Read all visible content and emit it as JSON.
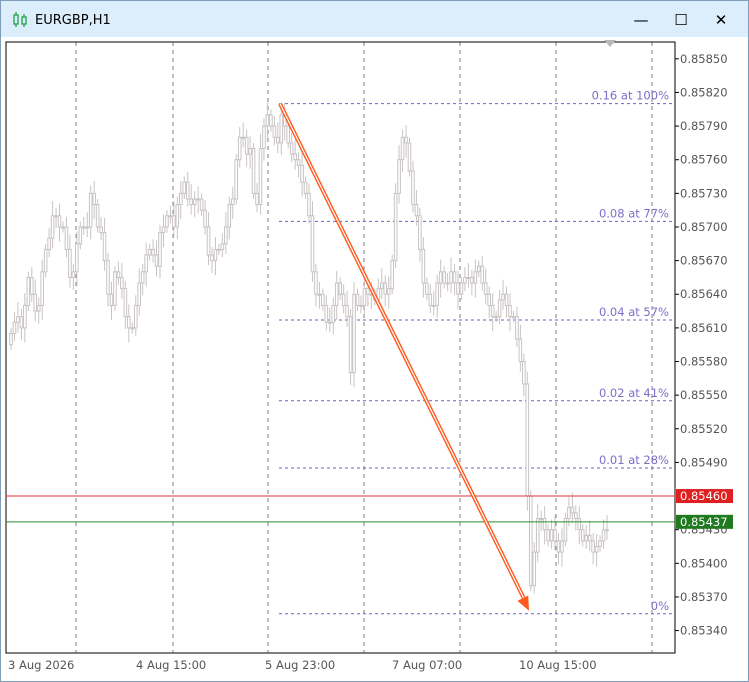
{
  "window": {
    "title": "EURGBP,H1",
    "minimize_glyph": "—",
    "maximize_glyph": "☐",
    "close_glyph": "✕"
  },
  "colors": {
    "candle": "#c9c3c3",
    "grid": "#4a4a4a",
    "fibo": "#6b62c4",
    "trend": "#ff5a1f",
    "ask_line": "#e03030",
    "bid_line": "#2a8a2a",
    "title_bg": "#dceefb"
  },
  "chart_data": {
    "type": "candlestick",
    "symbol": "EURGBP",
    "timeframe": "H1",
    "ylim": [
      0.8532,
      0.85865
    ],
    "y_ticks": [
      "0.85850",
      "0.85820",
      "0.85790",
      "0.85760",
      "0.85730",
      "0.85700",
      "0.85670",
      "0.85640",
      "0.85610",
      "0.85580",
      "0.85550",
      "0.85520",
      "0.85490",
      "0.85430",
      "0.85400",
      "0.85370",
      "0.85340"
    ],
    "x_ticks": [
      "3 Aug 2026",
      "4 Aug 15:00",
      "5 Aug 23:00",
      "7 Aug 07:00",
      "10 Aug 15:00"
    ],
    "ask_price": "0.85460",
    "bid_price": "0.85437",
    "fibonacci_levels": [
      {
        "label": "0.16 at 100%",
        "price": 0.8581
      },
      {
        "label": "0.08 at 77%",
        "price": 0.85705
      },
      {
        "label": "0.04 at 57%",
        "price": 0.85617
      },
      {
        "label": "0.02 at 41%",
        "price": 0.85545
      },
      {
        "label": "0.01 at 28%",
        "price": 0.85485
      },
      {
        "label": "0%",
        "price": 0.85355
      }
    ],
    "trend_line": {
      "from_price": 0.8581,
      "to_price": 0.85355
    },
    "closes": [
      0.85605,
      0.85615,
      0.8562,
      0.8561,
      0.8563,
      0.85655,
      0.8564,
      0.85625,
      0.8563,
      0.8566,
      0.8568,
      0.8569,
      0.8571,
      0.8571,
      0.857,
      0.857,
      0.8568,
      0.85655,
      0.8566,
      0.85685,
      0.857,
      0.857,
      0.857,
      0.8573,
      0.8572,
      0.857,
      0.85695,
      0.8567,
      0.8564,
      0.8563,
      0.8566,
      0.85655,
      0.85645,
      0.8562,
      0.8561,
      0.8561,
      0.8563,
      0.8565,
      0.8566,
      0.85675,
      0.8568,
      0.85675,
      0.85665,
      0.85695,
      0.857,
      0.8571,
      0.8571,
      0.857,
      0.8572,
      0.8573,
      0.8574,
      0.85725,
      0.8572,
      0.85725,
      0.85725,
      0.85715,
      0.857,
      0.85675,
      0.8567,
      0.8568,
      0.8568,
      0.85685,
      0.857,
      0.8572,
      0.85725,
      0.8576,
      0.8578,
      0.8578,
      0.85765,
      0.8577,
      0.8573,
      0.8572,
      0.8577,
      0.8579,
      0.858,
      0.8579,
      0.8578,
      0.85775,
      0.858,
      0.8579,
      0.85775,
      0.85765,
      0.8576,
      0.85755,
      0.8574,
      0.8573,
      0.8571,
      0.8566,
      0.8564,
      0.8564,
      0.8563,
      0.85615,
      0.85615,
      0.8563,
      0.8565,
      0.8564,
      0.8563,
      0.8562,
      0.8557,
      0.8564,
      0.8563,
      0.8563,
      0.85645,
      0.8564,
      0.8564,
      0.85635,
      0.85645,
      0.8565,
      0.8564,
      0.85645,
      0.8567,
      0.8573,
      0.8576,
      0.8578,
      0.85775,
      0.8575,
      0.8572,
      0.8571,
      0.8568,
      0.8565,
      0.8564,
      0.8563,
      0.8563,
      0.8565,
      0.8566,
      0.8565,
      0.8565,
      0.8566,
      0.8565,
      0.8564,
      0.8565,
      0.85655,
      0.85655,
      0.8565,
      0.8566,
      0.85665,
      0.8565,
      0.8564,
      0.8563,
      0.8562,
      0.8562,
      0.85635,
      0.8564,
      0.8563,
      0.8562,
      0.8562,
      0.856,
      0.8558,
      0.8556,
      0.8546,
      0.8538,
      0.8541,
      0.8544,
      0.8544,
      0.8543,
      0.8542,
      0.8543,
      0.8542,
      0.8541,
      0.8542,
      0.8544,
      0.8545,
      0.85445,
      0.8544,
      0.8543,
      0.8542,
      0.85425,
      0.8542,
      0.8541,
      0.85415,
      0.8542,
      0.8543,
      0.8543
    ]
  }
}
